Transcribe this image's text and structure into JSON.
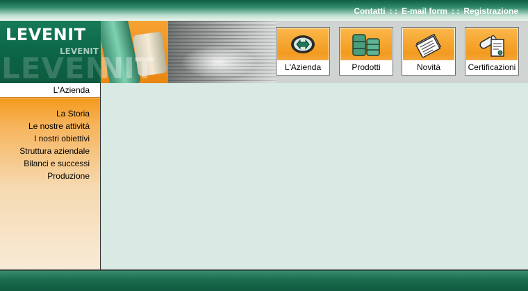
{
  "top_links": [
    {
      "label": "Contatti"
    },
    {
      "label": "E-mail form"
    },
    {
      "label": "Registrazione"
    }
  ],
  "separator": ": :",
  "logo": {
    "main": "LEVENIT",
    "small": "LEVENIT",
    "watermark": "LEVENIT"
  },
  "nav_buttons": [
    {
      "label": "L'Azienda",
      "icon": "company-icon"
    },
    {
      "label": "Prodotti",
      "icon": "barrels-icon"
    },
    {
      "label": "Novità",
      "icon": "newspaper-icon"
    },
    {
      "label": "Certificazioni",
      "icon": "certificate-icon"
    }
  ],
  "sidebar": {
    "heading": "L'Azienda",
    "items": [
      {
        "label": "La Storia"
      },
      {
        "label": "Le nostre attività"
      },
      {
        "label": "I nostri obiettivi"
      },
      {
        "label": "Struttura aziendale"
      },
      {
        "label": "Bilanci e successi "
      },
      {
        "label": "Produzione"
      }
    ]
  },
  "colors": {
    "brand_green": "#0b6446",
    "accent_orange": "#f29a1e",
    "content_bg": "#d9e9e3"
  }
}
